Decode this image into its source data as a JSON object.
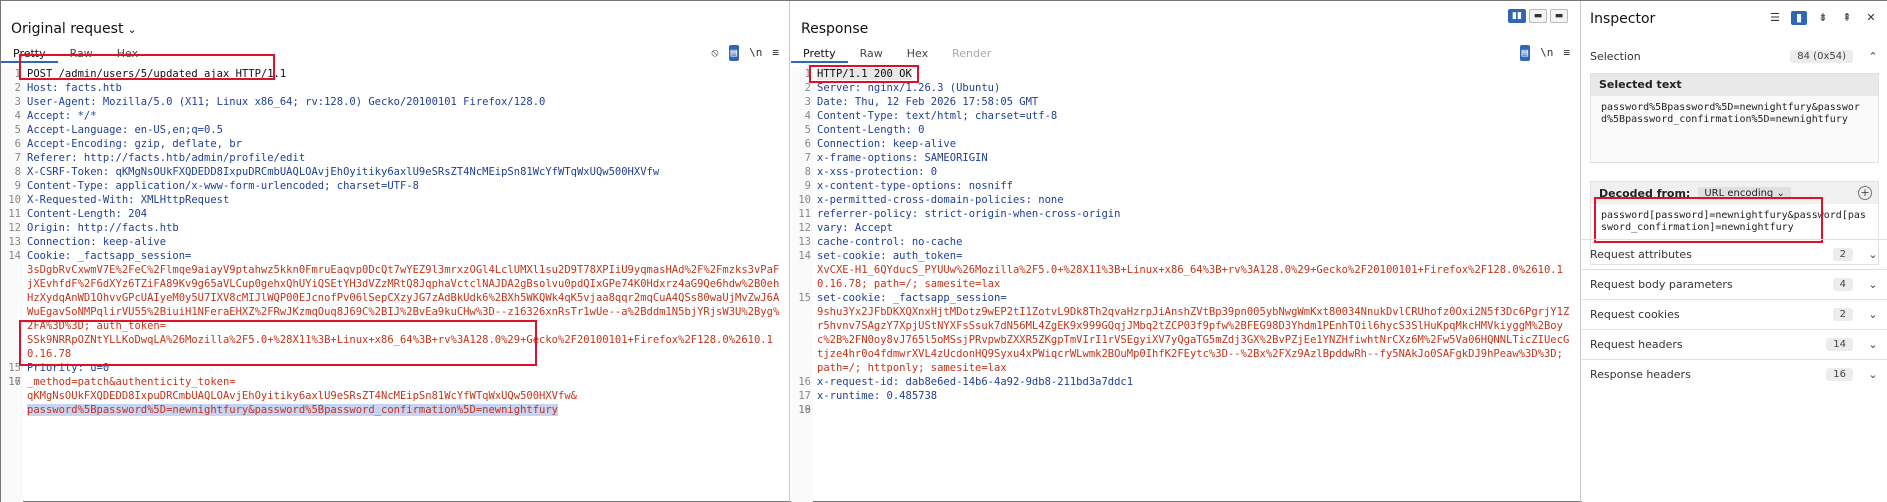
{
  "request": {
    "title": "Original request",
    "tabs": [
      "Pretty",
      "Raw",
      "Hex"
    ],
    "tools": [
      "⦸",
      "▤",
      "\\n",
      "≡"
    ],
    "lines": [
      {
        "n": "1",
        "cls": "plain",
        "text": "POST /admin/users/5/updated_ajax HTTP/1.1"
      },
      {
        "n": "2",
        "cls": "hdr",
        "text": "Host: facts.htb"
      },
      {
        "n": "3",
        "cls": "hdr",
        "text": "User-Agent: Mozilla/5.0 (X11; Linux x86_64; rv:128.0) Gecko/20100101 Firefox/128.0"
      },
      {
        "n": "4",
        "cls": "hdr",
        "text": "Accept: */*"
      },
      {
        "n": "5",
        "cls": "hdr",
        "text": "Accept-Language: en-US,en;q=0.5"
      },
      {
        "n": "6",
        "cls": "hdr",
        "text": "Accept-Encoding: gzip, deflate, br"
      },
      {
        "n": "7",
        "cls": "hdr",
        "text": "Referer: http://facts.htb/admin/profile/edit"
      },
      {
        "n": "8",
        "cls": "hdr",
        "text": "X-CSRF-Token: qKMgNsOUkFXQDEDD8IxpuDRCmbUAQLOAvjEhOyitiky6axlU9eSRsZT4NcMEipSn81WcYfWTqWxUQw500HXVfw"
      },
      {
        "n": "9",
        "cls": "hdr",
        "text": "Content-Type: application/x-www-form-urlencoded; charset=UTF-8"
      },
      {
        "n": "10",
        "cls": "hdr",
        "text": "X-Requested-With: XMLHttpRequest"
      },
      {
        "n": "11",
        "cls": "hdr",
        "text": "Content-Length: 204"
      },
      {
        "n": "12",
        "cls": "hdr",
        "text": "Origin: http://facts.htb"
      },
      {
        "n": "13",
        "cls": "hdr",
        "text": "Connection: keep-alive"
      },
      {
        "n": "14",
        "cls": "hdr",
        "text": "Cookie: _factsapp_session="
      },
      {
        "n": "",
        "cls": "cookie",
        "text": "3sDgbRvCxwmV7E%2FeC%2Flmqe9aiayV9ptahwz5kkn0FmruEaqvp0DcQt7wYEZ9l3mrxzOGl4LclUMXl1su2D9T78XPIiU9yqmasHAd%2F%2Fmzks3vPaFjXEvhfdF%2F6dXYz6TZiFA89Kv9g65aVLCup0gehxQhUYiQSEtYH3dVZzMRtQ8JqphaVctclNAJDA2gBsolvu0pdQIxGPe74K0Hdxrz4aG9Qe6hdw%2B0ehHzXydqAnWD1OhvvGPcUAIyeM0y5U7IXV8cMIJlWQP00EJcnofPv06lSepCXzyJG7zAdBkUdk6%2BXh5WKQWk4qK5vjaa8qqr2mqCuA4QSs80waUjMvZwJ6AWuEgavSoNMPqlirVU55%2BiuiH1NFeraEHXZ%2FRwJKzmqOuq8J69C%2BIJ%2BvEa9kuCHw%3D--z16326xnRsTr1wUe--a%2Bddm1N5bjYRjsW3U%2Byg%2FA%3D%3D; auth_token="
      },
      {
        "n": "",
        "cls": "cookie",
        "text": "SSk9NRRpOZNtYLLKoDwqLA%26Mozilla%2F5.0+%28X11%3B+Linux+x86_64%3B+rv%3A128.0%29+Gecko%2F20100101+Firefox%2F128.0%2610.10.16.78"
      },
      {
        "n": "15",
        "cls": "hdr",
        "text": "Priority: u=0"
      },
      {
        "n": "16",
        "cls": "plain",
        "text": ""
      },
      {
        "n": "17",
        "cls": "cookie",
        "text": "_method=patch&authenticity_token="
      },
      {
        "n": "",
        "cls": "cookie",
        "text": "qKMgNsOUkFXQDEDD8IxpuDRCmbUAQLOAvjEhOyitiky6axlU9eSRsZT4NcMEipSn81WcYfWTqWxUQw500HXVfw&"
      },
      {
        "n": "",
        "cls": "cookie sel",
        "text": "password%5Bpassword%5D=newnightfury&password%5Bpassword_confirmation%5D=newnightfury"
      }
    ]
  },
  "response": {
    "title": "Response",
    "tabs": [
      "Pretty",
      "Raw",
      "Hex",
      "Render"
    ],
    "tools": [
      "▤",
      "\\n",
      "≡"
    ],
    "layout_buttons": [
      "▮▮",
      "▬",
      "▬"
    ],
    "lines": [
      {
        "n": "1",
        "cls": "plain hl",
        "text": "HTTP/1.1 200 OK"
      },
      {
        "n": "2",
        "cls": "hdr",
        "text": "Server: nginx/1.26.3 (Ubuntu)"
      },
      {
        "n": "3",
        "cls": "hdr",
        "text": "Date: Thu, 12 Feb 2026 17:58:05 GMT"
      },
      {
        "n": "4",
        "cls": "hdr",
        "text": "Content-Type: text/html; charset=utf-8"
      },
      {
        "n": "5",
        "cls": "hdr",
        "text": "Content-Length: 0"
      },
      {
        "n": "6",
        "cls": "hdr",
        "text": "Connection: keep-alive"
      },
      {
        "n": "7",
        "cls": "hdr",
        "text": "x-frame-options: SAMEORIGIN"
      },
      {
        "n": "8",
        "cls": "hdr",
        "text": "x-xss-protection: 0"
      },
      {
        "n": "9",
        "cls": "hdr",
        "text": "x-content-type-options: nosniff"
      },
      {
        "n": "10",
        "cls": "hdr",
        "text": "x-permitted-cross-domain-policies: none"
      },
      {
        "n": "11",
        "cls": "hdr",
        "text": "referrer-policy: strict-origin-when-cross-origin"
      },
      {
        "n": "12",
        "cls": "hdr",
        "text": "vary: Accept"
      },
      {
        "n": "13",
        "cls": "hdr",
        "text": "cache-control: no-cache"
      },
      {
        "n": "14",
        "cls": "hdr",
        "text": "set-cookie: auth_token="
      },
      {
        "n": "",
        "cls": "cookie",
        "text": "XvCXE-H1_6QYducS_PYUUw%26Mozilla%2F5.0+%28X11%3B+Linux+x86_64%3B+rv%3A128.0%29+Gecko%2F20100101+Firefox%2F128.0%2610.10.16.78; path=/; samesite=lax"
      },
      {
        "n": "15",
        "cls": "hdr",
        "text": "set-cookie: _factsapp_session="
      },
      {
        "n": "",
        "cls": "cookie",
        "text": "9shu3Yx2JFbDKXQXnxHjtMDotz9wEP2tI1ZotvL9Dk8Th2qvaHzrpJiAnshZVtBp39pn005ybNwgWmKxt80034NnukDvlCRUhofz0Oxi2N5f3Dc6PgrjY1Zr5hvnv7SAgzY7XpjUStNYXFsSsuk7dN56ML4ZgEK9x999GQqjJMbq2tZCP03f9pfw%2BFEG98D3Yhdm1PEnhTOil6hycS3SlHuKpqMkcHMVkiyggM%2Boyc%2B%2FN0oy8vJ765l5oMSsjPRvpwbZXXR5ZKgpTmVIrI1rVSEgyiXV7yQgaTG5mZdj3GX%2BvPZjEe1YNZHfiwhtNrCXz6M%2Fw5Va06HQNNLTicZIUecGtjze4hr0o4fdmwrXVL4zUcdonHQ9Syxu4xPWiqcrWLwmk2BOuMp0IhfK2FEytc%3D--%2Bx%2FXz9AzlBpddwRh--fy5NAkJo0SAFgkDJ9hPeaw%3D%3D; path=/; httponly; samesite=lax"
      },
      {
        "n": "16",
        "cls": "hdr",
        "text": "x-request-id: dab8e6ed-14b6-4a92-9db8-211bd3a7ddc1"
      },
      {
        "n": "17",
        "cls": "hdr",
        "text": "x-runtime: 0.485738"
      },
      {
        "n": "18",
        "cls": "plain",
        "text": ""
      },
      {
        "n": "19",
        "cls": "plain",
        "text": ""
      }
    ]
  },
  "inspector": {
    "title": "Inspector",
    "tools": [
      "☰",
      "▮",
      "⇟",
      "⇞",
      "✕"
    ],
    "selection_label": "Selection",
    "selection_badge": "84 (0x54)",
    "selected_text_label": "Selected text",
    "selected_text": "password%5Bpassword%5D=newnightfury&password%5Bpassword_confirmation%5D=newnightfury",
    "decoded_from_label": "Decoded from:",
    "decoded_from_value": "URL encoding ⌄",
    "decoded_text": "password[password]=newnightfury&password[password_confirmation]=newnightfury",
    "sections": [
      {
        "label": "Request attributes",
        "count": "2"
      },
      {
        "label": "Request body parameters",
        "count": "4"
      },
      {
        "label": "Request cookies",
        "count": "2"
      },
      {
        "label": "Request headers",
        "count": "14"
      },
      {
        "label": "Response headers",
        "count": "16"
      }
    ]
  },
  "colors": {
    "accent": "#2f67b4",
    "highlight_box": "#e0102a",
    "header_name": "#1f3f9a",
    "cookie_value": "#c7331a"
  }
}
